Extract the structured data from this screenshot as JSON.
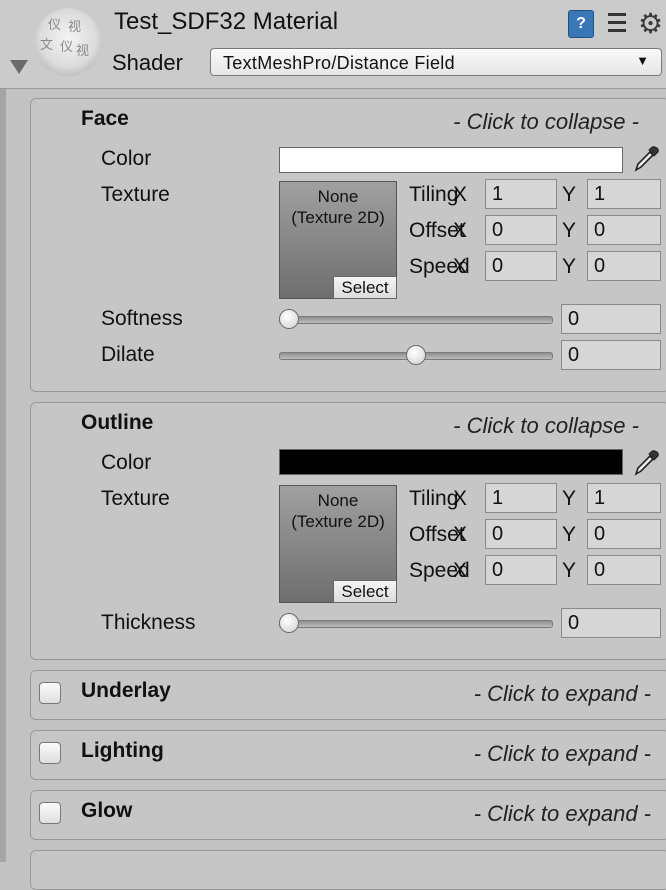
{
  "header": {
    "title": "Test_SDF32 Material",
    "shader_label": "Shader",
    "shader_value": "TextMeshPro/Distance Field",
    "dropdown_arrow": "▼",
    "help_icon_text": "?",
    "gear_icon": "⚙",
    "thumb_glyphs": [
      "仪",
      "视",
      "文",
      "仪",
      "视"
    ]
  },
  "face": {
    "title": "Face",
    "hint": "- Click to collapse -",
    "color_label": "Color",
    "color_value": "#ffffff",
    "texture_label": "Texture",
    "texture_none": "None",
    "texture_type": "(Texture 2D)",
    "select_label": "Select",
    "tiling_label": "Tiling",
    "offset_label": "Offset",
    "speed_label": "Speed",
    "x_label": "X",
    "y_label": "Y",
    "tiling_x": "1",
    "tiling_y": "1",
    "offset_x": "0",
    "offset_y": "0",
    "speed_x": "0",
    "speed_y": "0",
    "softness_label": "Softness",
    "softness_value": "0",
    "softness_fraction": 0.0,
    "dilate_label": "Dilate",
    "dilate_value": "0",
    "dilate_fraction": 0.5
  },
  "outline": {
    "title": "Outline",
    "hint": "- Click to collapse -",
    "color_label": "Color",
    "color_value": "#000000",
    "texture_label": "Texture",
    "texture_none": "None",
    "texture_type": "(Texture 2D)",
    "select_label": "Select",
    "tiling_label": "Tiling",
    "offset_label": "Offset",
    "speed_label": "Speed",
    "x_label": "X",
    "y_label": "Y",
    "tiling_x": "1",
    "tiling_y": "1",
    "offset_x": "0",
    "offset_y": "0",
    "speed_x": "0",
    "speed_y": "0",
    "thickness_label": "Thickness",
    "thickness_value": "0",
    "thickness_fraction": 0.0
  },
  "collapsed_sections": [
    {
      "title": "Underlay",
      "hint": "- Click to expand -",
      "enabled": false
    },
    {
      "title": "Lighting",
      "hint": "- Click to expand -",
      "enabled": false
    },
    {
      "title": "Glow",
      "hint": "- Click to expand -",
      "enabled": false
    }
  ]
}
